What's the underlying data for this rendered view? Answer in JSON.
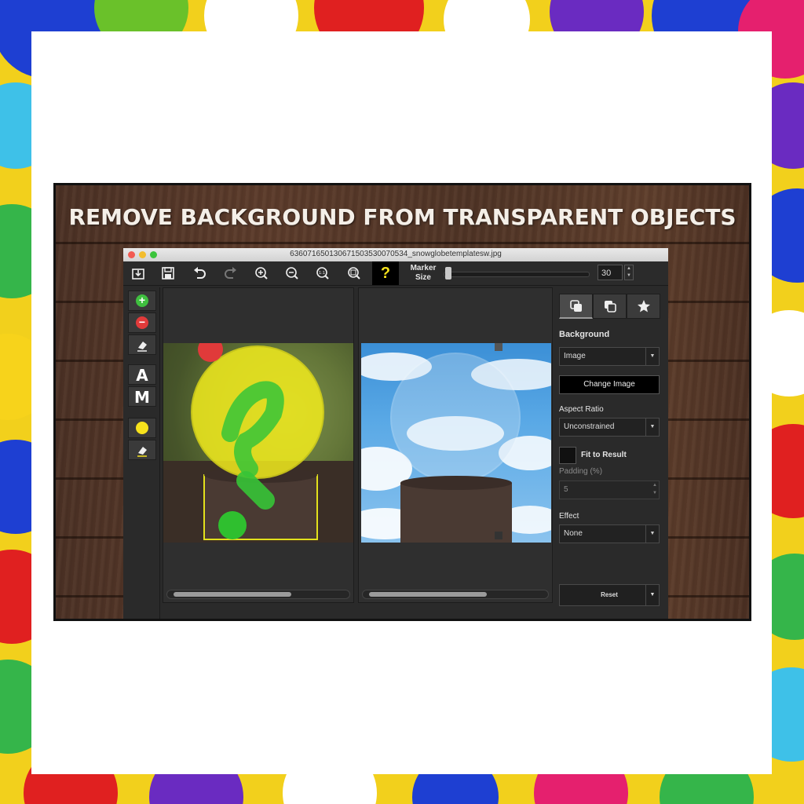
{
  "banner": {
    "title": "REMOVE BACKGROUND FROM TRANSPARENT OBJECTS"
  },
  "window": {
    "title": "636071650130671503530070534_snowglobetemplatesw.jpg"
  },
  "toolbar": {
    "marker_label_line1": "Marker",
    "marker_label_line2": "Size",
    "marker_size": "30",
    "help_label": "?"
  },
  "tools": {
    "auto_label": "A",
    "manual_label": "M"
  },
  "panel": {
    "background_label": "Background",
    "background_value": "Image",
    "change_image_label": "Change Image",
    "aspect_ratio_label": "Aspect Ratio",
    "aspect_ratio_value": "Unconstrained",
    "fit_to_result_label": "Fit to Result",
    "padding_label": "Padding (%)",
    "padding_value": "5",
    "effect_label": "Effect",
    "effect_value": "None",
    "reset_label": "Reset"
  },
  "colors": {
    "accent_yellow": "#f6e21c",
    "keep_green": "#3fbf3f",
    "remove_red": "#e03a3a"
  }
}
